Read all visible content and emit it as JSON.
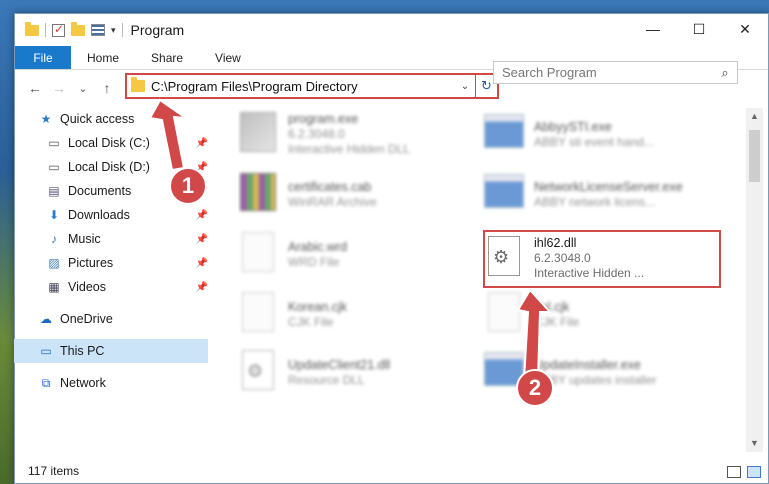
{
  "window": {
    "title": "Program",
    "controls": {
      "minimize": "—",
      "maximize": "☐",
      "close": "✕"
    }
  },
  "quick_access_toolbar": {
    "dropdown": "▾"
  },
  "ribbon": {
    "tabs": [
      {
        "label": "File"
      },
      {
        "label": "Home"
      },
      {
        "label": "Share"
      },
      {
        "label": "View"
      }
    ]
  },
  "nav": {
    "back": "←",
    "forward": "→",
    "recent": "⌄",
    "up": "↑"
  },
  "address": {
    "path": "C:\\Program Files\\Program Directory",
    "dropdown": "⌄",
    "refresh": "↻"
  },
  "search": {
    "placeholder": "Search Program",
    "icon": "⌕"
  },
  "sidebar": {
    "items": [
      {
        "label": "Quick access",
        "icon": "★",
        "pinned": false
      },
      {
        "label": "Local Disk (C:)",
        "icon": "▭",
        "pinned": true
      },
      {
        "label": "Local Disk (D:)",
        "icon": "▭",
        "pinned": true
      },
      {
        "label": "Documents",
        "icon": "▤",
        "pinned": true
      },
      {
        "label": "Downloads",
        "icon": "⬇",
        "pinned": true
      },
      {
        "label": "Music",
        "icon": "♪",
        "pinned": true
      },
      {
        "label": "Pictures",
        "icon": "▨",
        "pinned": true
      },
      {
        "label": "Videos",
        "icon": "▦",
        "pinned": true
      },
      {
        "label": "OneDrive",
        "icon": "☁",
        "pinned": false
      },
      {
        "label": "This PC",
        "icon": "▭",
        "pinned": false
      },
      {
        "label": "Network",
        "icon": "⧉",
        "pinned": false
      }
    ],
    "pin_glyph": "📌"
  },
  "files": [
    {
      "name": "program.exe",
      "line2": "6.2.3048.0",
      "line3": "Interactive Hidden DLL",
      "thumb": "exe"
    },
    {
      "name": "AbbyySTI.exe",
      "line2": "ABBY sti event hand...",
      "line3": "",
      "thumb": "app"
    },
    {
      "name": "certificates.cab",
      "line2": "WinRAR Archive",
      "line3": "",
      "thumb": "rar"
    },
    {
      "name": "NetworkLicenseServer.exe",
      "line2": "ABBY network licens...",
      "line3": "",
      "thumb": "app"
    },
    {
      "name": "Arabic.wrd",
      "line2": "WRD File",
      "line3": "",
      "thumb": "doc"
    },
    {
      "name": "ihl62.dll",
      "line2": "6.2.3048.0",
      "line3": "Interactive Hidden ...",
      "thumb": "dll"
    },
    {
      "name": "Korean.cjk",
      "line2": "CJK File",
      "line3": "",
      "thumb": "doc"
    },
    {
      "name": "Ital.cjk",
      "line2": "CJK File",
      "line3": "",
      "thumb": "doc"
    },
    {
      "name": "UpdateClient21.dll",
      "line2": "Resource DLL",
      "line3": "",
      "thumb": "dll"
    },
    {
      "name": "UpdateInstaller.exe",
      "line2": "ABBY updates installer",
      "line3": "",
      "thumb": "app"
    }
  ],
  "status": {
    "item_count": "117 items"
  },
  "callouts": [
    {
      "label": "1"
    },
    {
      "label": "2"
    }
  ],
  "colors": {
    "accent": "#1979ca",
    "highlight": "#d04848",
    "selection": "#cce4f7"
  }
}
